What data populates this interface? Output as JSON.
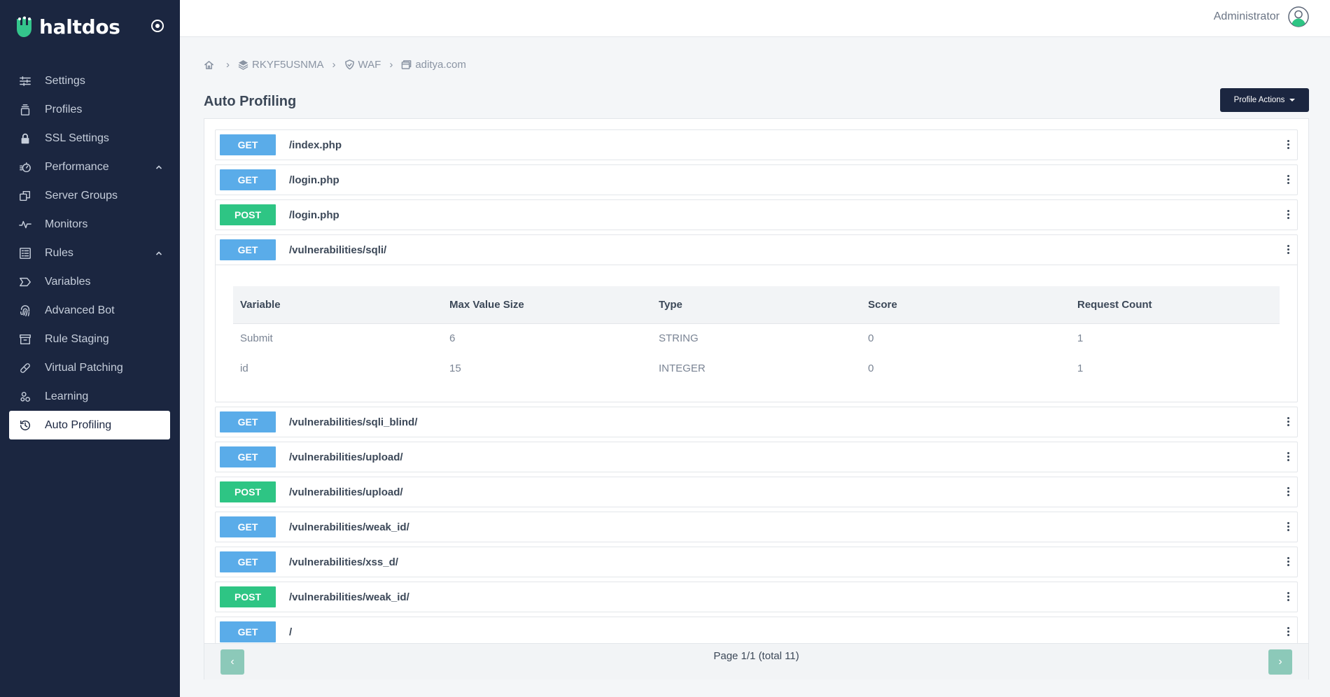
{
  "brand": {
    "name": "haltdos"
  },
  "sidebar": {
    "items": [
      {
        "label": "Settings",
        "icon": "sliders-icon",
        "name": "sidebar-item-settings"
      },
      {
        "label": "Profiles",
        "icon": "stack-icon",
        "name": "sidebar-item-profiles"
      },
      {
        "label": "SSL Settings",
        "icon": "lock-icon",
        "name": "sidebar-item-ssl-settings"
      },
      {
        "label": "Performance",
        "icon": "speedometer-icon",
        "name": "sidebar-item-performance",
        "expandable": true
      },
      {
        "label": "Server Groups",
        "icon": "copy-icon",
        "name": "sidebar-item-server-groups"
      },
      {
        "label": "Monitors",
        "icon": "pulse-icon",
        "name": "sidebar-item-monitors"
      },
      {
        "label": "Rules",
        "icon": "list-icon",
        "name": "sidebar-item-rules",
        "expandable": true
      },
      {
        "label": "Variables",
        "icon": "tag-icon",
        "name": "sidebar-item-variables"
      },
      {
        "label": "Advanced Bot",
        "icon": "fingerprint-icon",
        "name": "sidebar-item-advanced-bot"
      },
      {
        "label": "Rule Staging",
        "icon": "archive-icon",
        "name": "sidebar-item-rule-staging"
      },
      {
        "label": "Virtual Patching",
        "icon": "bandage-icon",
        "name": "sidebar-item-virtual-patching"
      },
      {
        "label": "Learning",
        "icon": "nodes-icon",
        "name": "sidebar-item-learning"
      },
      {
        "label": "Auto Profiling",
        "icon": "history-icon",
        "name": "sidebar-item-auto-profiling",
        "active": true
      }
    ]
  },
  "header": {
    "user_name": "Administrator"
  },
  "breadcrumb": {
    "items": [
      {
        "label": "",
        "icon": "home-icon"
      },
      {
        "label": "RKYF5USNMA",
        "icon": "layers-icon"
      },
      {
        "label": "WAF",
        "icon": "shield-icon"
      },
      {
        "label": "aditya.com",
        "icon": "window-icon"
      }
    ],
    "separator": "›"
  },
  "page": {
    "title": "Auto Profiling",
    "actions_label": "Profile Actions"
  },
  "routes": [
    {
      "method": "GET",
      "path": "/index.php"
    },
    {
      "method": "GET",
      "path": "/login.php"
    },
    {
      "method": "POST",
      "path": "/login.php"
    },
    {
      "method": "GET",
      "path": "/vulnerabilities/sqli/",
      "expanded": true
    },
    {
      "method": "GET",
      "path": "/vulnerabilities/sqli_blind/"
    },
    {
      "method": "GET",
      "path": "/vulnerabilities/upload/"
    },
    {
      "method": "POST",
      "path": "/vulnerabilities/upload/"
    },
    {
      "method": "GET",
      "path": "/vulnerabilities/weak_id/"
    },
    {
      "method": "GET",
      "path": "/vulnerabilities/xss_d/"
    },
    {
      "method": "POST",
      "path": "/vulnerabilities/weak_id/"
    },
    {
      "method": "GET",
      "path": "/"
    }
  ],
  "variables_table": {
    "columns": [
      "Variable",
      "Max Value Size",
      "Type",
      "Score",
      "Request Count"
    ],
    "rows": [
      [
        "Submit",
        "6",
        "STRING",
        "0",
        "1"
      ],
      [
        "id",
        "15",
        "INTEGER",
        "0",
        "1"
      ]
    ]
  },
  "pager": {
    "text": "Page 1/1 (total 11)",
    "prev": "‹",
    "next": "›"
  },
  "colors": {
    "sidebar": "#1b2640",
    "get": "#5aace9",
    "post": "#2ec584",
    "pager_button": "#8cc9b9"
  }
}
